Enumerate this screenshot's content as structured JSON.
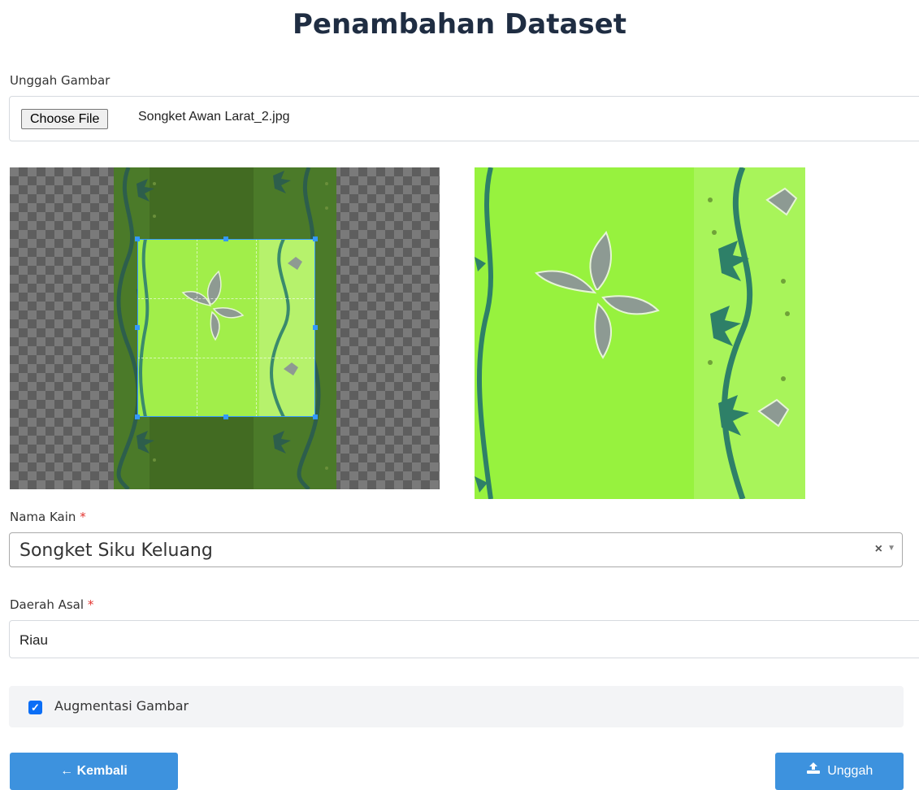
{
  "page": {
    "title": "Penambahan Dataset"
  },
  "upload": {
    "label": "Unggah Gambar",
    "button_label": "Choose File",
    "file_name": "Songket Awan Larat_2.jpg"
  },
  "nama_kain": {
    "label": "Nama Kain",
    "required_mark": "*",
    "value": "Songket Siku Keluang",
    "clear_icon": "×",
    "arrow_icon": "▼"
  },
  "daerah_asal": {
    "label": "Daerah Asal",
    "required_mark": "*",
    "value": "Riau"
  },
  "augmentasi": {
    "label": "Augmentasi Gambar",
    "checked": true
  },
  "buttons": {
    "back_label": "Kembali",
    "back_icon": "←",
    "upload_label": "Unggah",
    "upload_icon": "upload-icon"
  },
  "colors": {
    "title": "#1f2d42",
    "primary_button": "#3d92de",
    "required": "#e3342f",
    "crop_border": "#3399ff",
    "fabric_green": "#97f23e",
    "fabric_dark": "#426b22"
  }
}
